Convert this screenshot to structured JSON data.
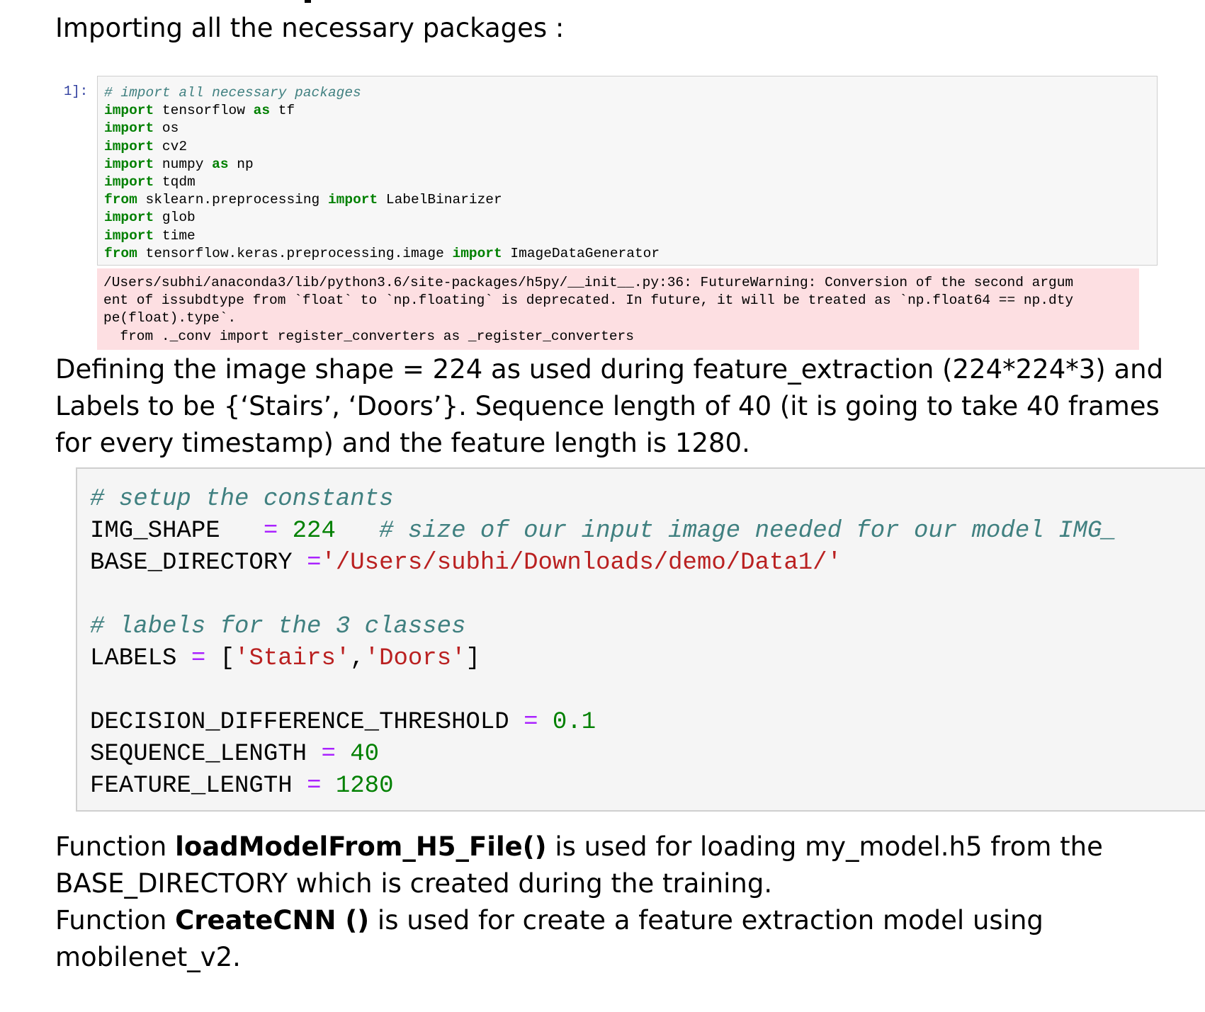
{
  "heading": "Importing all the necessary packages :",
  "cell1": {
    "prompt": "1]:",
    "lines": [
      [
        {
          "t": "# import all necessary packages",
          "c": "cm"
        }
      ],
      [
        {
          "t": "import",
          "c": "kw"
        },
        {
          "t": " tensorflow ",
          "c": ""
        },
        {
          "t": "as",
          "c": "kw"
        },
        {
          "t": " tf",
          "c": ""
        }
      ],
      [
        {
          "t": "import",
          "c": "kw"
        },
        {
          "t": " os",
          "c": ""
        }
      ],
      [
        {
          "t": "import",
          "c": "kw"
        },
        {
          "t": " cv2",
          "c": ""
        }
      ],
      [
        {
          "t": "import",
          "c": "kw"
        },
        {
          "t": " numpy ",
          "c": ""
        },
        {
          "t": "as",
          "c": "kw"
        },
        {
          "t": " np",
          "c": ""
        }
      ],
      [
        {
          "t": "import",
          "c": "kw"
        },
        {
          "t": " tqdm",
          "c": ""
        }
      ],
      [
        {
          "t": "from",
          "c": "kw"
        },
        {
          "t": " sklearn.preprocessing ",
          "c": ""
        },
        {
          "t": "import",
          "c": "kw"
        },
        {
          "t": " LabelBinarizer",
          "c": ""
        }
      ],
      [
        {
          "t": "import",
          "c": "kw"
        },
        {
          "t": " glob",
          "c": ""
        }
      ],
      [
        {
          "t": "import",
          "c": "kw"
        },
        {
          "t": " time",
          "c": ""
        }
      ],
      [
        {
          "t": "from",
          "c": "kw"
        },
        {
          "t": " tensorflow.keras.preprocessing.image ",
          "c": ""
        },
        {
          "t": "import",
          "c": "kw"
        },
        {
          "t": " ImageDataGenerator",
          "c": ""
        }
      ]
    ]
  },
  "warning": "/Users/subhi/anaconda3/lib/python3.6/site-packages/h5py/__init__.py:36: FutureWarning: Conversion of the second argum\nent of issubdtype from `float` to `np.floating` is deprecated. In future, it will be treated as `np.float64 == np.dty\npe(float).type`.\n  from ._conv import register_converters as _register_converters",
  "para1": "Defining the image shape = 224 as used during feature_extraction (224*224*3) and Labels to be {‘Stairs’, ‘Doors’}. Sequence length of 40 (it is going to take 40 frames for every timestamp) and the feature length is 1280.",
  "cell2": {
    "lines": [
      [
        {
          "t": "# setup the constants",
          "c": "cm"
        }
      ],
      [
        {
          "t": "IMG_SHAPE   ",
          "c": ""
        },
        {
          "t": "=",
          "c": "op"
        },
        {
          "t": " ",
          "c": ""
        },
        {
          "t": "224",
          "c": "num"
        },
        {
          "t": "   ",
          "c": ""
        },
        {
          "t": "# size of our input image needed for our model IMG_",
          "c": "cm"
        }
      ],
      [
        {
          "t": "BASE_DIRECTORY ",
          "c": ""
        },
        {
          "t": "=",
          "c": "op"
        },
        {
          "t": "'/Users/subhi/Downloads/demo/Data1/'",
          "c": "str"
        }
      ],
      [],
      [
        {
          "t": "# labels for the 3 classes",
          "c": "cm"
        }
      ],
      [
        {
          "t": "LABELS ",
          "c": ""
        },
        {
          "t": "=",
          "c": "op"
        },
        {
          "t": " [",
          "c": ""
        },
        {
          "t": "'Stairs'",
          "c": "str"
        },
        {
          "t": ",",
          "c": ""
        },
        {
          "t": "'Doors'",
          "c": "str"
        },
        {
          "t": "]",
          "c": ""
        }
      ],
      [],
      [
        {
          "t": "DECISION_DIFFERENCE_THRESHOLD ",
          "c": ""
        },
        {
          "t": "=",
          "c": "op"
        },
        {
          "t": " ",
          "c": ""
        },
        {
          "t": "0.1",
          "c": "num"
        }
      ],
      [
        {
          "t": "SEQUENCE_LENGTH ",
          "c": ""
        },
        {
          "t": "=",
          "c": "op"
        },
        {
          "t": " ",
          "c": ""
        },
        {
          "t": "40",
          "c": "num"
        }
      ],
      [
        {
          "t": "FEATURE_LENGTH ",
          "c": ""
        },
        {
          "t": "=",
          "c": "op"
        },
        {
          "t": " ",
          "c": ""
        },
        {
          "t": "1280",
          "c": "num"
        }
      ]
    ]
  },
  "para2": {
    "line1_pre": "Function ",
    "line1_bold": "loadModelFrom_H5_File()",
    "line1_post": " is used for loading my_model.h5 from the BASE_DIRECTORY which is created during the training.",
    "line2_pre": "Function ",
    "line2_bold": "CreateCNN ()",
    "line2_post": " is used for create a feature extraction model using mobilenet_v2."
  }
}
